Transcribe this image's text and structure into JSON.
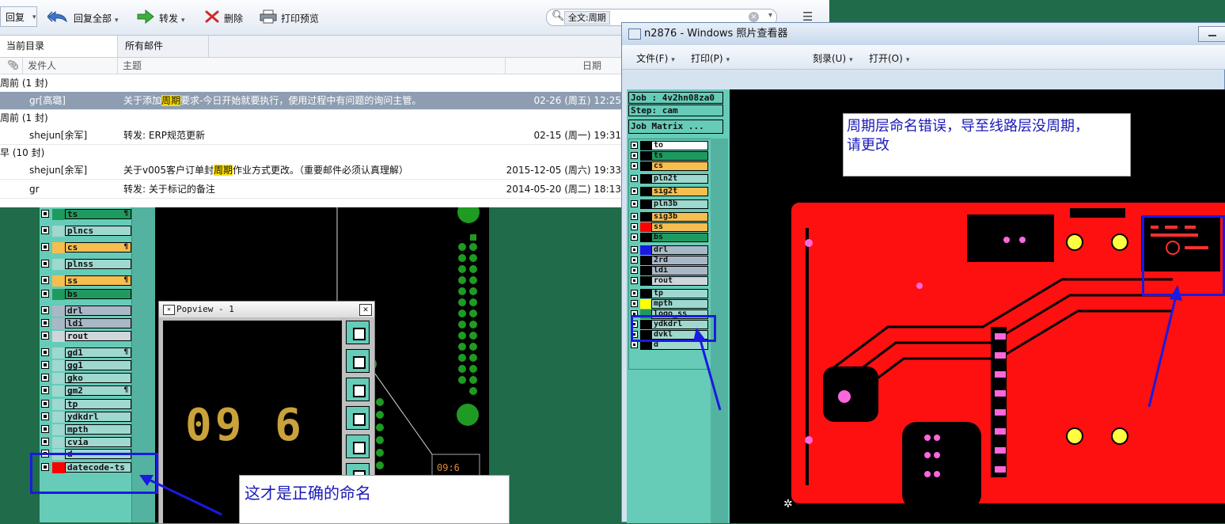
{
  "toolbar": {
    "reply": "回复",
    "reply_all": "回复全部",
    "forward": "转发",
    "delete": "删除",
    "print_preview": "打印预览",
    "search_value": "全文:周期"
  },
  "tabs": [
    "当前目录",
    "所有邮件"
  ],
  "columns": {
    "from": "发件人",
    "subject": "主题",
    "date": "日期"
  },
  "groups": [
    "周前 (1 封)",
    "周前 (1 封)",
    "早 (10 封)"
  ],
  "emails": [
    {
      "from": "gr[高璐]",
      "subj_pre": "关于添加",
      "subj_hl": "周期",
      "subj_post": "要求-今日开始就要执行，使用过程中有问题的询问主管。",
      "date": "02-26 (周五) 12:25"
    },
    {
      "from": "shejun[余军]",
      "subj_pre": "转发: ERP规范更新",
      "subj_hl": "",
      "subj_post": "",
      "date": "02-15 (周一) 19:31"
    },
    {
      "from": "shejun[余军]",
      "subj_pre": "关于v005客户订单封",
      "subj_hl": "周期",
      "subj_post": "作业方式更改。（重要邮件必须认真理解）",
      "date": "2015-12-05 (周六) 19:33"
    },
    {
      "from": "gr",
      "subj_pre": "转发: 关于标记的备注",
      "subj_hl": "",
      "subj_post": "",
      "date": "2014-05-20 (周二) 18:13"
    }
  ],
  "left_layers": [
    {
      "name": "ts",
      "color": "#1f9a5e",
      "sw": "#1f9a5e",
      "note": "¶"
    },
    {
      "name": "plncs",
      "color": "#9ed8cf",
      "sw": "#9ed8cf",
      "note": ""
    },
    {
      "name": "cs",
      "color": "#f6bd4f",
      "sw": "#f6bd4f",
      "note": "¶"
    },
    {
      "name": "plnss",
      "color": "#9ed8cf",
      "sw": "#9ed8cf",
      "note": ""
    },
    {
      "name": "ss",
      "color": "#f6bd4f",
      "sw": "#f6bd4f",
      "note": "¶"
    },
    {
      "name": "bs",
      "color": "#1f9a5e",
      "sw": "#1f9a5e",
      "note": ""
    },
    {
      "name": "drl",
      "color": "#a9b8c6",
      "sw": "#a9b8c6",
      "note": ""
    },
    {
      "name": "ldi",
      "color": "#a9b8c6",
      "sw": "#a9b8c6",
      "note": ""
    },
    {
      "name": "rout",
      "color": "#cfd5da",
      "sw": "#cfd5da",
      "note": ""
    },
    {
      "name": "gd1",
      "color": "#9ed8cf",
      "sw": "#9ed8cf",
      "note": "¶"
    },
    {
      "name": "gg1",
      "color": "#9ed8cf",
      "sw": "#9ed8cf",
      "note": ""
    },
    {
      "name": "gko",
      "color": "#9ed8cf",
      "sw": "#9ed8cf",
      "note": ""
    },
    {
      "name": "gm2",
      "color": "#9ed8cf",
      "sw": "#9ed8cf",
      "note": "¶"
    },
    {
      "name": "tp",
      "color": "#9ed8cf",
      "sw": "#9ed8cf",
      "note": ""
    },
    {
      "name": "ydkdrl",
      "color": "#9ed8cf",
      "sw": "#9ed8cf",
      "note": ""
    },
    {
      "name": "mpth",
      "color": "#9ed8cf",
      "sw": "#9ed8cf",
      "note": ""
    },
    {
      "name": "cvia",
      "color": "#9ed8cf",
      "sw": "#9ed8cf",
      "note": ""
    },
    {
      "name": "d",
      "color": "#9ed8cf",
      "sw": "#9ed8cf",
      "note": ""
    },
    {
      "name": "datecode-ts",
      "color": "#9ed8cf",
      "sw": "#ff0000",
      "note": ""
    }
  ],
  "popview": {
    "title": "Popview - 1",
    "digits": "09 6",
    "mini": "09:6"
  },
  "note_left": "这才是正确的命名",
  "viewer": {
    "title": "n2876 - Windows 照片查看器",
    "menu": [
      "文件(F)",
      "打印(P)",
      "刻录(U)",
      "打开(O)"
    ],
    "job": "Job : 4v2hn08za0",
    "step": "Step: cam",
    "matrix": "Job Matrix ...",
    "layers": [
      {
        "name": "to",
        "color": "#ffffff",
        "sw": "#000000"
      },
      {
        "name": "ts",
        "color": "#1f9a5e",
        "sw": "#000000"
      },
      {
        "name": "cs",
        "color": "#f6bd4f",
        "sw": "#000000"
      },
      {
        "name": "pln2t",
        "color": "#9ed8cf",
        "sw": "#000000"
      },
      {
        "name": "sig2t",
        "color": "#f6bd4f",
        "sw": "#000000"
      },
      {
        "name": "pln3b",
        "color": "#9ed8cf",
        "sw": "#000000"
      },
      {
        "name": "sig3b",
        "color": "#f6bd4f",
        "sw": "#000000"
      },
      {
        "name": "ss",
        "color": "#f6bd4f",
        "sw": "#ff0000"
      },
      {
        "name": "bs",
        "color": "#1f9a5e",
        "sw": "#000000"
      },
      {
        "name": "drl",
        "color": "#a9b8c6",
        "sw": "#1a1ae0"
      },
      {
        "name": "2rd",
        "color": "#a9b8c6",
        "sw": "#000000"
      },
      {
        "name": "ldi",
        "color": "#a9b8c6",
        "sw": "#000000"
      },
      {
        "name": "rout",
        "color": "#cfd5da",
        "sw": "#000000"
      },
      {
        "name": "tp",
        "color": "#9ed8cf",
        "sw": "#000000"
      },
      {
        "name": "mpth",
        "color": "#9ed8cf",
        "sw": "#ffff00"
      },
      {
        "name": "logo_ss",
        "color": "#9ed8cf",
        "sw": "#1f9a5e"
      },
      {
        "name": "ydkdrl",
        "color": "#9ed8cf",
        "sw": "#000000"
      },
      {
        "name": "dvkl",
        "color": "#9ed8cf",
        "sw": "#000000"
      },
      {
        "name": "d",
        "color": "#9ed8cf",
        "sw": "#000000"
      }
    ],
    "note": [
      "周期层命名错误，导至线路层没周期，",
      "请更改"
    ]
  }
}
